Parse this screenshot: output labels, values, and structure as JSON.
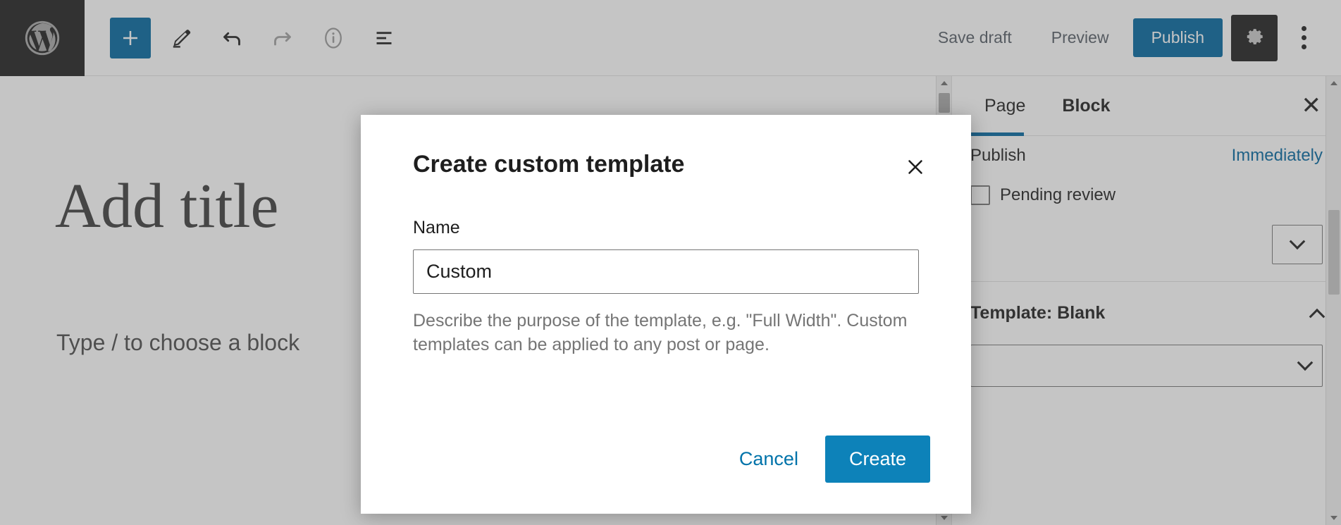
{
  "toolbar": {
    "logo_icon": "wordpress-logo-icon",
    "left_buttons": [
      {
        "name": "add-block-button",
        "icon": "plus-icon",
        "label": "Toggle block inserter"
      },
      {
        "name": "edit-tool-button",
        "icon": "pencil-icon",
        "label": "Tools"
      },
      {
        "name": "undo-button",
        "icon": "undo-arrow-icon",
        "label": "Undo"
      },
      {
        "name": "redo-button",
        "icon": "redo-arrow-icon",
        "label": "Redo"
      },
      {
        "name": "details-button",
        "icon": "info-circle-icon",
        "label": "Details"
      },
      {
        "name": "list-view-button",
        "icon": "list-view-icon",
        "label": "List View"
      }
    ],
    "save_draft_label": "Save draft",
    "preview_label": "Preview",
    "publish_label": "Publish",
    "settings_icon": "gear-icon",
    "options_icon": "kebab-menu-icon",
    "accent_color": "#00669e"
  },
  "canvas": {
    "title_placeholder": "Add title",
    "paragraph_placeholder": "Type / to choose a block"
  },
  "sidebar": {
    "tabs": [
      {
        "label": "Page",
        "active": false
      },
      {
        "label": "Block",
        "active": true
      }
    ],
    "close_label": "✕",
    "publish_row": {
      "label": "Publish",
      "value": "Immediately"
    },
    "pending_review": {
      "label": "Pending review"
    },
    "template_panel": {
      "title": "Template: Blank",
      "chevron": "chevron-up-icon",
      "select_value": ""
    }
  },
  "modal": {
    "title": "Create custom template",
    "close_label": "✕",
    "name_label": "Name",
    "name_value": "Custom",
    "name_placeholder": "Custom",
    "help_text": "Describe the purpose of the template, e.g. \"Full Width\". Custom templates can be applied to any post or page.",
    "cancel_label": "Cancel",
    "create_label": "Create",
    "create_color": "#0d82b9",
    "cancel_color": "#0073aa"
  }
}
